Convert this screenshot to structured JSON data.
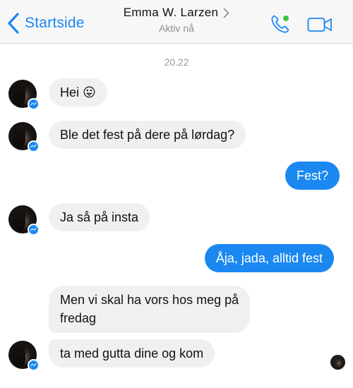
{
  "header": {
    "back_label": "Startside",
    "contact_name": "Emma W. Larzen",
    "status": "Aktiv nå",
    "call_icon": "phone-icon",
    "video_icon": "video-camera-icon"
  },
  "timestamp": "20.22",
  "messages": [
    {
      "direction": "incoming",
      "text": "Hei 😛"
    },
    {
      "direction": "incoming",
      "text": "Ble det fest på dere på lørdag?"
    },
    {
      "direction": "outgoing",
      "text": "Fest?"
    },
    {
      "direction": "incoming",
      "text": "Ja så på insta"
    },
    {
      "direction": "outgoing",
      "text": "Åja, jada, alltid fest"
    },
    {
      "direction": "incoming",
      "lines": [
        "Men vi skal ha vors hos meg på",
        "fredag"
      ]
    },
    {
      "direction": "incoming",
      "text": "ta med gutta dine og kom"
    }
  ],
  "colors": {
    "accent": "#1a88f0",
    "online": "#3ec43e",
    "incoming_bubble": "#f0f0f0",
    "header_bg": "#f7f7f7"
  }
}
